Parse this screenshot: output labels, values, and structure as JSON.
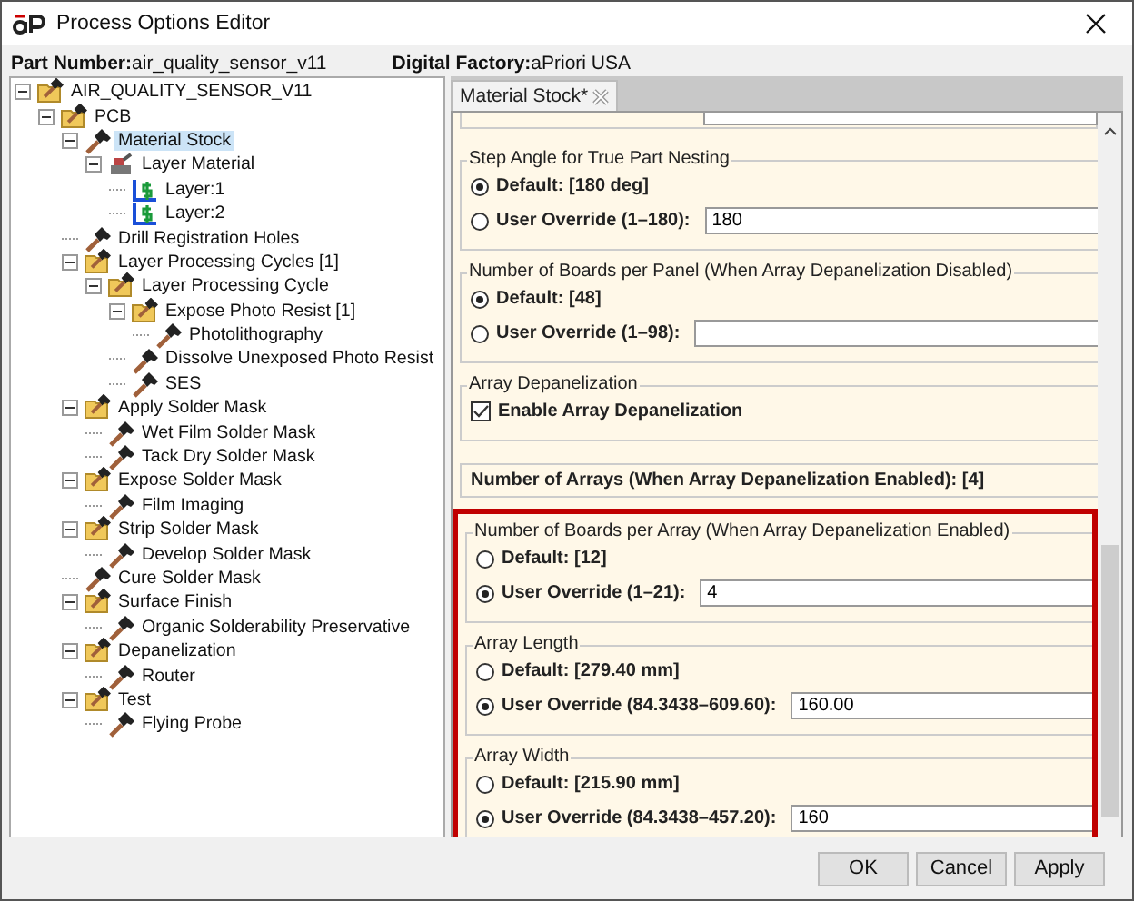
{
  "window": {
    "title": "Process Options Editor"
  },
  "info": [
    {
      "label": "Part Number:",
      "value": "air_quality_sensor_v11"
    },
    {
      "label": "Digital Factory:",
      "value": "aPriori USA"
    }
  ],
  "tree": [
    {
      "label": "AIR_QUALITY_SENSOR_V11",
      "kind": "folder",
      "selected": false,
      "expanded": true,
      "children": [
        {
          "label": "PCB",
          "kind": "folder",
          "selected": false,
          "expanded": true,
          "children": [
            {
              "label": "Material Stock",
              "kind": "process",
              "selected": true,
              "expanded": true,
              "children": [
                {
                  "label": "Layer Material",
                  "kind": "machine",
                  "selected": false,
                  "expanded": true,
                  "children": [
                    {
                      "label": "Layer:1",
                      "kind": "layer",
                      "selected": false
                    },
                    {
                      "label": "Layer:2",
                      "kind": "layer",
                      "selected": false
                    }
                  ]
                }
              ]
            },
            {
              "label": "Drill Registration Holes",
              "kind": "process",
              "selected": false
            },
            {
              "label": "Layer Processing Cycles [1]",
              "kind": "folder",
              "selected": false,
              "expanded": true,
              "children": [
                {
                  "label": "Layer Processing Cycle",
                  "kind": "folder",
                  "selected": false,
                  "expanded": true,
                  "children": [
                    {
                      "label": "Expose Photo Resist [1]",
                      "kind": "folder",
                      "selected": false,
                      "expanded": true,
                      "children": [
                        {
                          "label": "Photolithography",
                          "kind": "process",
                          "selected": false
                        }
                      ]
                    },
                    {
                      "label": "Dissolve Unexposed Photo Resist",
                      "kind": "process",
                      "selected": false
                    },
                    {
                      "label": "SES",
                      "kind": "process",
                      "selected": false
                    }
                  ]
                }
              ]
            },
            {
              "label": "Apply Solder Mask",
              "kind": "folder",
              "selected": false,
              "expanded": true,
              "children": [
                {
                  "label": "Wet Film Solder Mask",
                  "kind": "process",
                  "selected": false
                },
                {
                  "label": "Tack Dry Solder Mask",
                  "kind": "process",
                  "selected": false
                }
              ]
            },
            {
              "label": "Expose Solder Mask",
              "kind": "folder",
              "selected": false,
              "expanded": true,
              "children": [
                {
                  "label": "Film Imaging",
                  "kind": "process",
                  "selected": false
                }
              ]
            },
            {
              "label": "Strip Solder Mask",
              "kind": "folder",
              "selected": false,
              "expanded": true,
              "children": [
                {
                  "label": "Develop Solder Mask",
                  "kind": "process",
                  "selected": false
                }
              ]
            },
            {
              "label": "Cure Solder Mask",
              "kind": "process",
              "selected": false
            },
            {
              "label": "Surface Finish",
              "kind": "folder",
              "selected": false,
              "expanded": true,
              "children": [
                {
                  "label": "Organic Solderability Preservative",
                  "kind": "process",
                  "selected": false
                }
              ]
            },
            {
              "label": "Depanelization",
              "kind": "folder",
              "selected": false,
              "expanded": true,
              "children": [
                {
                  "label": "Router",
                  "kind": "process",
                  "selected": false
                }
              ]
            },
            {
              "label": "Test",
              "kind": "folder",
              "selected": false,
              "expanded": true,
              "children": [
                {
                  "label": "Flying Probe",
                  "kind": "process",
                  "selected": false
                }
              ]
            }
          ]
        }
      ]
    }
  ],
  "tabs": [
    {
      "label": "Material Stock*",
      "selected": true
    }
  ],
  "groups": [
    {
      "kind": "radio",
      "highlighted": false,
      "title": "Step Angle for True Part Nesting",
      "options": [
        {
          "label": "Default: [180 deg]",
          "selected": true
        },
        {
          "label": "User Override (1–180):",
          "selected": false,
          "value": "180"
        }
      ]
    },
    {
      "kind": "radio",
      "highlighted": false,
      "title": "Number of Boards per Panel (When Array Depanelization Disabled)",
      "options": [
        {
          "label": "Default: [48]",
          "selected": true
        },
        {
          "label": "User Override (1–98):",
          "selected": false
        }
      ]
    },
    {
      "kind": "checkbox",
      "highlighted": false,
      "title": "Array Depanelization",
      "options": [
        {
          "label": "Enable Array Depanelization",
          "checked": true
        }
      ]
    },
    {
      "kind": "info",
      "highlighted": false,
      "title": "Number of Arrays (When Array Depanelization Enabled): [4]"
    },
    {
      "kind": "radio",
      "highlighted": true,
      "title": "Number of Boards per Array (When Array Depanelization Enabled)",
      "options": [
        {
          "label": "Default: [12]",
          "selected": false
        },
        {
          "label": "User Override (1–21):",
          "selected": true,
          "value": "4"
        }
      ]
    },
    {
      "kind": "radio",
      "highlighted": true,
      "title": "Array Length",
      "options": [
        {
          "label": "Default: [279.40 mm]",
          "selected": false
        },
        {
          "label": "User Override (84.3438–609.60):",
          "selected": true,
          "value": "160.00"
        }
      ]
    },
    {
      "kind": "radio",
      "highlighted": true,
      "title": "Array Width",
      "options": [
        {
          "label": "Default: [215.90 mm]",
          "selected": false
        },
        {
          "label": "User Override (84.3438–457.20):",
          "selected": true,
          "value": "160"
        }
      ]
    }
  ],
  "buttons": [
    "OK",
    "Cancel",
    "Apply"
  ]
}
